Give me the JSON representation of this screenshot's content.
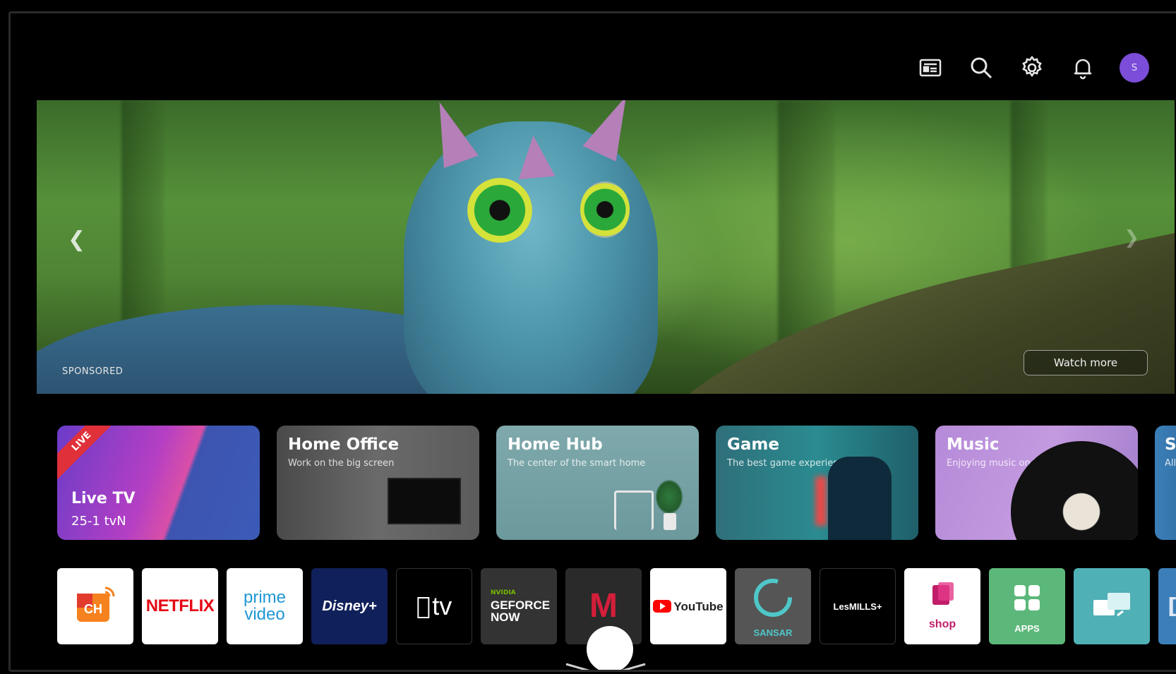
{
  "top_bar": {
    "icons": [
      "guide-icon",
      "search-icon",
      "settings-icon",
      "notification-icon"
    ],
    "avatar_initial": "S"
  },
  "hero": {
    "sponsored_label": "SPONSORED",
    "watch_more_label": "Watch more"
  },
  "cards": [
    {
      "id": "live-tv",
      "title": "Live TV",
      "channel": "25-1  tvN",
      "badge": "LIVE"
    },
    {
      "id": "home-office",
      "title": "Home Office",
      "subtitle": "Work on the big screen"
    },
    {
      "id": "home-hub",
      "title": "Home Hub",
      "subtitle": "The center of the smart home"
    },
    {
      "id": "game",
      "title": "Game",
      "subtitle": "The best game experience"
    },
    {
      "id": "music",
      "title": "Music",
      "subtitle": "Enjoying music on TV"
    },
    {
      "id": "sports",
      "title": "Sp",
      "subtitle": "All"
    }
  ],
  "apps": [
    {
      "name": "ch",
      "label": "CH"
    },
    {
      "name": "netflix",
      "label": "NETFLIX"
    },
    {
      "name": "prime-video",
      "label": "prime video"
    },
    {
      "name": "disney-plus",
      "label": "Disney+"
    },
    {
      "name": "apple-tv",
      "label": "tv"
    },
    {
      "name": "geforce-now",
      "label": "GEFORCE NOW",
      "sublabel": "NVIDIA"
    },
    {
      "name": "masterclass",
      "label": "M"
    },
    {
      "name": "youtube",
      "label": "YouTube"
    },
    {
      "name": "sansar",
      "label": "SANSAR"
    },
    {
      "name": "lesmills",
      "label": "LesMILLS+"
    },
    {
      "name": "shop-time",
      "label": "shop"
    },
    {
      "name": "apps",
      "label": "APPS"
    },
    {
      "name": "input",
      "label": ""
    },
    {
      "name": "more",
      "label": ""
    }
  ],
  "colors": {
    "accent_avatar": "#7b4dd8",
    "live_badge": "#e0313a"
  }
}
